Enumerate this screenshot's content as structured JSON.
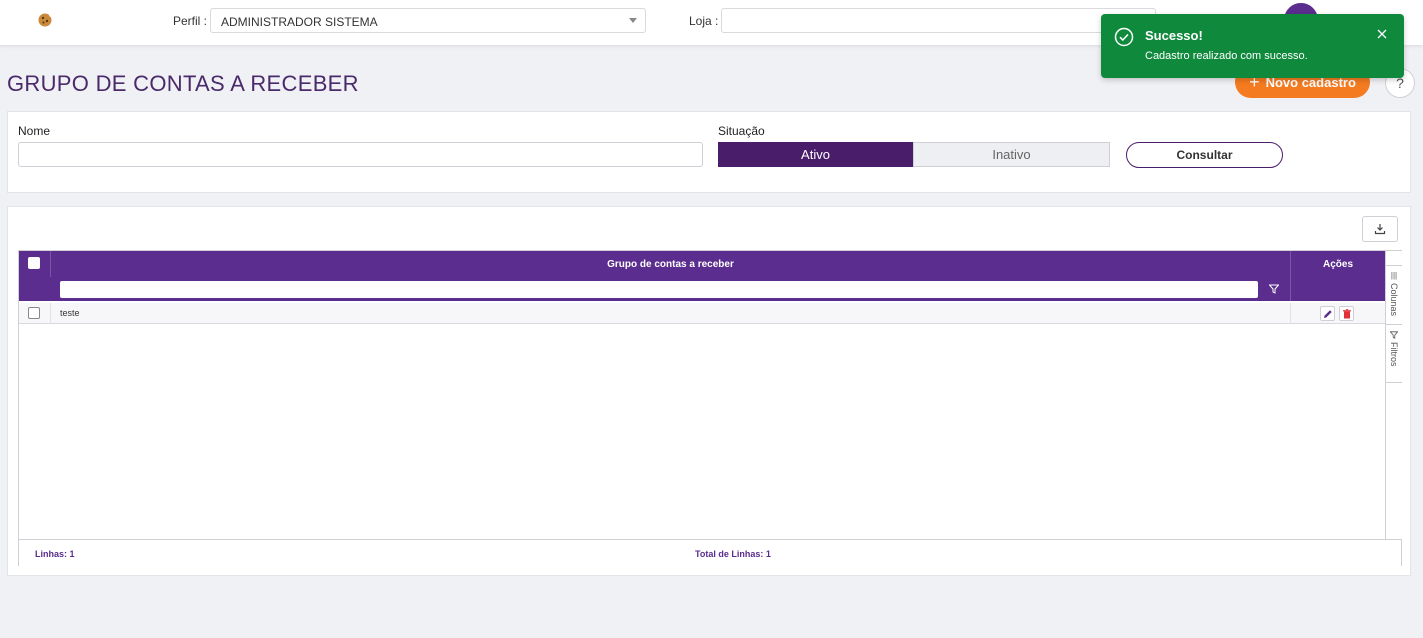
{
  "header": {
    "logo_icon": "cookie-logo-icon",
    "perfil_label": "Perfil :",
    "perfil_value": "ADMINISTRADOR SISTEMA",
    "loja_label": "Loja :",
    "loja_value": "",
    "avatar_icon": "user-avatar-icon"
  },
  "page": {
    "title": "GRUPO DE CONTAS A RECEBER",
    "new_button_label": "Novo cadastro",
    "help_label": "?"
  },
  "filters": {
    "nome_label": "Nome",
    "nome_value": "",
    "situacao_label": "Situação",
    "situacao_options": [
      "Ativo",
      "Inativo"
    ],
    "situacao_selected": "Ativo",
    "consultar_label": "Consultar"
  },
  "grid": {
    "column_title": "Grupo de contas a receber",
    "actions_title": "Ações",
    "filter_value": "",
    "rows": [
      {
        "name": "teste"
      }
    ],
    "side_tabs": {
      "colunas": "Colunas",
      "filtros": "Filtros"
    },
    "footer_left": "Linhas: 1",
    "footer_center": "Total de Linhas: 1"
  },
  "toast": {
    "title": "Sucesso!",
    "message": "Cadastro realizado com sucesso.",
    "color": "#0f8a3c"
  },
  "colors": {
    "primary": "#5b2d8e",
    "primary_dark": "#4a1d6b",
    "accent": "#f47b20",
    "danger": "#e0303a"
  }
}
